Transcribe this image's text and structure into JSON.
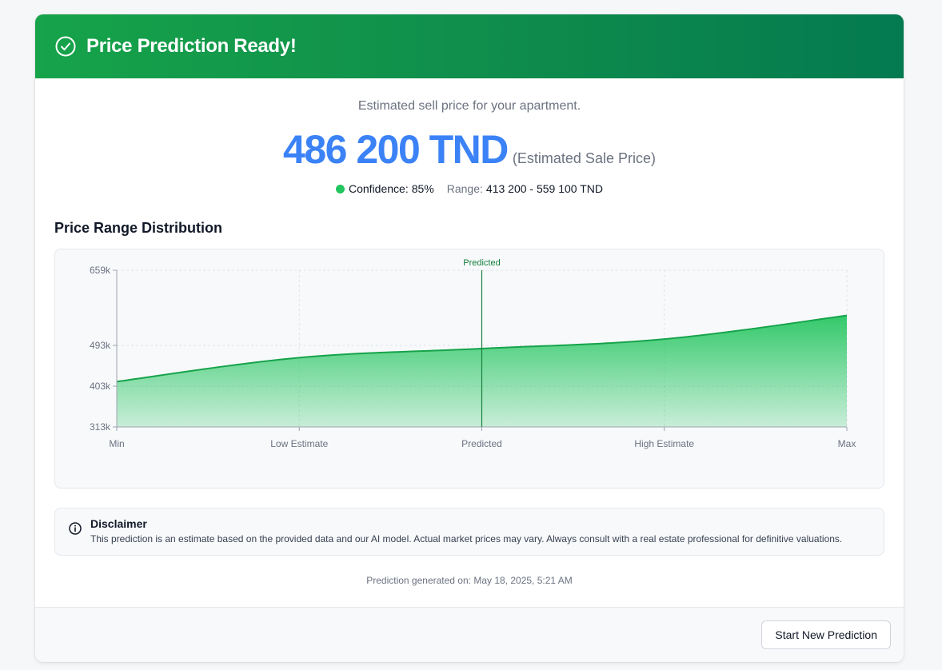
{
  "header": {
    "title": "Price Prediction Ready!",
    "icon": "check-circle-icon"
  },
  "result": {
    "subtitle": "Estimated sell price for your apartment.",
    "price": "486 200 TND",
    "price_note": "(Estimated Sale Price)",
    "confidence_label": "Confidence:",
    "confidence_value": "85%",
    "range_label": "Range:",
    "range_value": "413 200 - 559 100 TND"
  },
  "chart_section": {
    "title": "Price Range Distribution"
  },
  "chart_data": {
    "type": "area",
    "categories": [
      "Min",
      "Low Estimate",
      "Predicted",
      "High Estimate",
      "Max"
    ],
    "values": [
      413000,
      466000,
      486000,
      507000,
      559000
    ],
    "yticks": [
      "313k",
      "403k",
      "493k",
      "659k"
    ],
    "ytick_values": [
      313000,
      403000,
      493000,
      659000
    ],
    "ylim": [
      313000,
      659000
    ],
    "reference_line": {
      "category": "Predicted",
      "label": "Predicted"
    },
    "grid": true,
    "colors": {
      "line": "#16a34a",
      "fill": "#22c55e",
      "reference": "#15803d"
    }
  },
  "disclaimer": {
    "icon": "info-icon",
    "title": "Disclaimer",
    "text": "This prediction is an estimate based on the provided data and our AI model. Actual market prices may vary. Always consult with a real estate professional for definitive valuations."
  },
  "generated": "Prediction generated on: May 18, 2025, 5:21 AM",
  "footer": {
    "new_prediction_label": "Start New Prediction"
  },
  "colors": {
    "header_start": "#16a34a",
    "header_end": "#047a50",
    "price": "#3b82f6",
    "confidence_dot": "#22c55e"
  }
}
